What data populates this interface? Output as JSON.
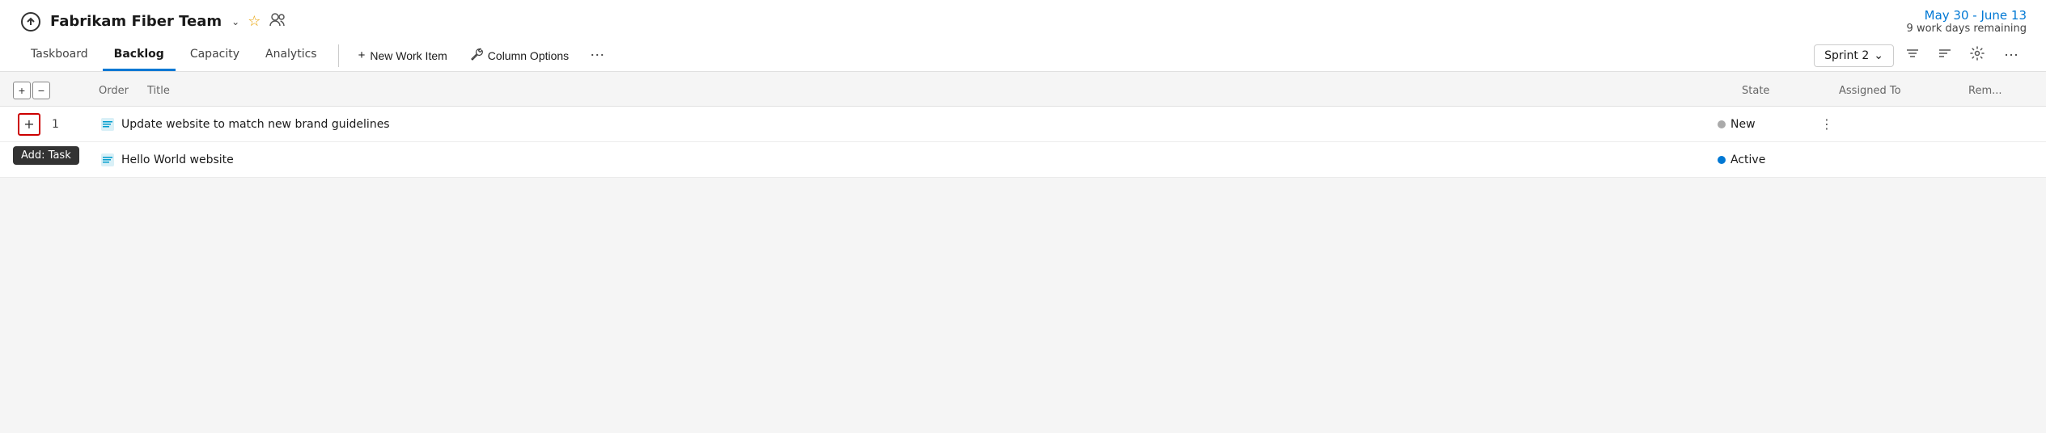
{
  "team": {
    "name": "Fabrikam Fiber Team",
    "icon": "☍"
  },
  "sprint": {
    "dates": "May 30 - June 13",
    "days_remaining": "9 work days remaining",
    "current": "Sprint 2"
  },
  "nav": {
    "tabs": [
      {
        "id": "taskboard",
        "label": "Taskboard",
        "active": false
      },
      {
        "id": "backlog",
        "label": "Backlog",
        "active": true
      },
      {
        "id": "capacity",
        "label": "Capacity",
        "active": false
      },
      {
        "id": "analytics",
        "label": "Analytics",
        "active": false
      }
    ],
    "actions": [
      {
        "id": "new-work-item",
        "icon": "+",
        "label": "New Work Item"
      },
      {
        "id": "column-options",
        "icon": "🔧",
        "label": "Column Options"
      }
    ],
    "more_label": "⋯"
  },
  "toolbar_right": {
    "sprint_label": "Sprint 2",
    "filter_icon": "⊟",
    "sort_icon": "≡",
    "settings_icon": "⚙",
    "more_icon": "⋯"
  },
  "table": {
    "headers": {
      "order": "Order",
      "title": "Title",
      "state": "State",
      "assigned": "Assigned To",
      "remaining": "Rem..."
    },
    "expand_plus": "+",
    "expand_minus": "−",
    "rows": [
      {
        "order": "1",
        "title": "Update website to match new brand guidelines",
        "state": "New",
        "state_type": "new",
        "assigned": "",
        "remaining": ""
      },
      {
        "order": "",
        "title": "Hello World website",
        "state": "Active",
        "state_type": "active",
        "assigned": "",
        "remaining": ""
      }
    ]
  },
  "tooltip": {
    "label": "Add: Task"
  }
}
